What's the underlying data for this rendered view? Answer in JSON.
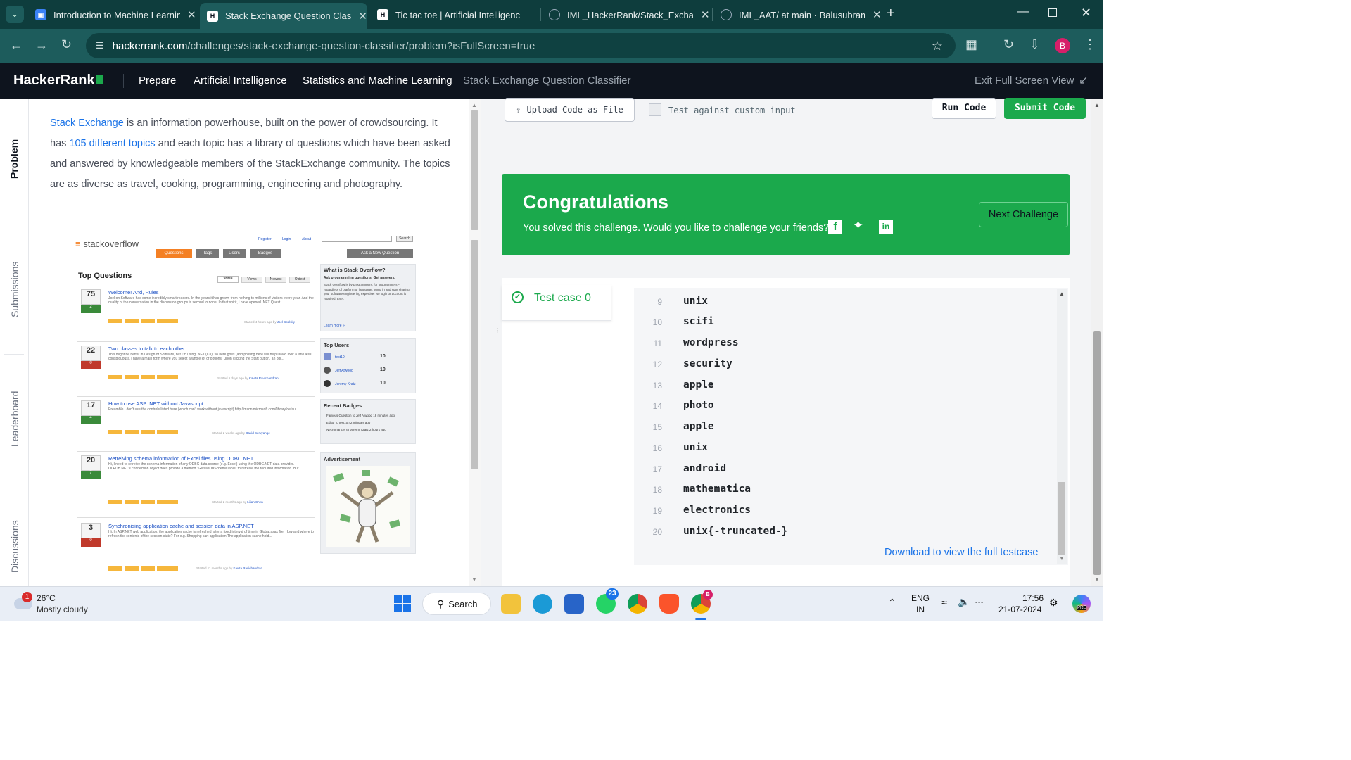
{
  "browser": {
    "tabs": [
      {
        "title": "Introduction to Machine Learnin",
        "favicon": "blue-doc-icon",
        "active": false
      },
      {
        "title": "Stack Exchange Question Classi",
        "favicon": "hackerrank-icon",
        "active": true
      },
      {
        "title": "Tic tac toe | Artificial Intelligenc",
        "favicon": "hackerrank-icon",
        "active": false
      },
      {
        "title": "IML_HackerRank/Stack_Exchang",
        "favicon": "github-icon",
        "active": false
      },
      {
        "title": "IML_AAT/ at main · Balusubram",
        "favicon": "github-icon",
        "active": false
      }
    ],
    "url_host": "hackerrank.com",
    "url_path": "/challenges/stack-exchange-question-classifier/problem?isFullScreen=true",
    "profile_initial": "B"
  },
  "header": {
    "logo": "HackerRank",
    "crumbs": [
      "Prepare",
      "Artificial Intelligence",
      "Statistics and Machine Learning",
      "Stack Exchange Question Classifier"
    ],
    "exit_label": "Exit Full Screen View"
  },
  "rail": {
    "tabs": [
      "Problem",
      "Submissions",
      "Leaderboard",
      "Discussions"
    ]
  },
  "problem": {
    "link1": "Stack Exchange",
    "text1": " is an information powerhouse, built on the power of crowdsourcing. It has ",
    "link2": "105 different topics",
    "text2": " and each topic has a library of questions which have been asked and answered by knowledgeable members of the StackExchange community. The topics are as diverse as travel, cooking, programming, engineering and photography."
  },
  "so_image": {
    "logo": "stackoverflow",
    "toplinks": [
      "Register",
      "Login",
      "About"
    ],
    "search_btn": "Search",
    "nav": [
      "Questions",
      "Tags",
      "Users",
      "Badges"
    ],
    "ask": "Ask a New Question",
    "heading": "Top Questions",
    "sort_tabs": [
      "Votes",
      "Views",
      "Newest",
      "Oldest"
    ],
    "questions": [
      {
        "votes": "75",
        "answers": "2",
        "title": "Welcome! And, Rules",
        "excerpt": "Joel on Software has some incredibly smart readers. In the years it has grown from nothing to millions of visitors every year. And the quality of the conversation in the discussion groups is second to none. In that spirit, I have opened .NET Quest...",
        "meta": "Started 4 hours ago by",
        "user": "Joel Spolsky"
      },
      {
        "votes": "22",
        "answers": "0",
        "title": "Two classes to talk to each other",
        "excerpt": "This might be better in Design of Software, but I'm using .NET (C#), so here goes (and posting here will help David look a little less conspicuous). I have a main form where you select a whole lot of options. Upon clicking the Start button, an obj...",
        "meta": "Started 6 days ago by",
        "user": "Kavita Ravichandran"
      },
      {
        "votes": "17",
        "answers": "4",
        "title": "How to use ASP .NET without Javascript",
        "excerpt": "Preamble I don't use the controls listed here (which can't work without javascript) http://msdn.microsoft.com/library/defaul...",
        "meta": "Started 2 weeks ago by",
        "user": "David Seruyange"
      },
      {
        "votes": "20",
        "answers": "7",
        "title": "Retreiving schema information of Excel files using ODBC.NET",
        "excerpt": "Hi, I need to retreive the schema information of any ODBC data source (e.g. Excel) using the ODBC.NET data provider. OLEDB.NET's connection object does provide a method \"GetOleDBSchemaTable\" to retreive the required information. But...",
        "meta": "Started 2 months ago by",
        "user": "Lilian Chen"
      },
      {
        "votes": "3",
        "answers": "0",
        "title": "Synchronising application cache and session data in ASP.NET",
        "excerpt": "Hi, In ASP.NET web application, the application cache is refreshed after a fixed interval of time in Global.asax file. How and where to refresh the contents of the session state? For e.g. Shopping cart application The application cache hold...",
        "meta": "Started 11 months ago by",
        "user": "Kavita Ravichandran"
      }
    ],
    "side": {
      "what_title": "What is Stack Overflow?",
      "what_sub": "Ask programming questions. Get answers.",
      "what_text": "Stack Overflow is by programmers, for programmers -- regardless of platform or language. Jump in and start sharing your software engineering expertise! No login or account is required. Ever.",
      "learn_more": "Learn more »",
      "top_users_title": "Top Users",
      "top_users": [
        {
          "name": "test10",
          "score": "10"
        },
        {
          "name": "Jeff Atwood",
          "score": "10"
        },
        {
          "name": "Jeremy Kratz",
          "score": "10"
        }
      ],
      "badges_title": "Recent Badges",
      "badges": [
        "Famous Question to Jeff Atwood 18 minutes ago",
        "Editor to test10 42 minutes ago",
        "Necromancer to Jeremy Kratz 2 hours ago"
      ],
      "ad_title": "Advertisement"
    }
  },
  "editor": {
    "upload_label": "Upload Code as File",
    "custom_label": "Test against custom input",
    "run_label": "Run Code",
    "submit_label": "Submit Code"
  },
  "congrats": {
    "title": "Congratulations",
    "text": "You solved this challenge. Would you like to challenge your friends?",
    "next_label": "Next Challenge"
  },
  "results": {
    "testcase": "Test case 0",
    "lines": [
      {
        "n": "9",
        "v": "unix"
      },
      {
        "n": "10",
        "v": "scifi"
      },
      {
        "n": "11",
        "v": "wordpress"
      },
      {
        "n": "12",
        "v": "security"
      },
      {
        "n": "13",
        "v": "apple"
      },
      {
        "n": "14",
        "v": "photo"
      },
      {
        "n": "15",
        "v": "apple"
      },
      {
        "n": "16",
        "v": "unix"
      },
      {
        "n": "17",
        "v": "android"
      },
      {
        "n": "18",
        "v": "mathematica"
      },
      {
        "n": "19",
        "v": "electronics"
      },
      {
        "n": "20",
        "v": "unix{-truncated-}"
      }
    ],
    "download_label": "Download to view the full testcase"
  },
  "taskbar": {
    "weather_badge": "1",
    "temp": "26°C",
    "condition": "Mostly cloudy",
    "search_label": "Search",
    "whatsapp_badge": "23",
    "lang_top": "ENG",
    "lang_bottom": "IN",
    "time": "17:56",
    "date": "21-07-2024",
    "chrome_badge": "B",
    "copilot_label": "PRE"
  },
  "colors": {
    "tab_strip": "#0e3d3d",
    "addr_bar": "#1d5c5c",
    "hr_header": "#0e141e",
    "hr_green": "#1ba94c",
    "link_blue": "#1a73e8"
  }
}
